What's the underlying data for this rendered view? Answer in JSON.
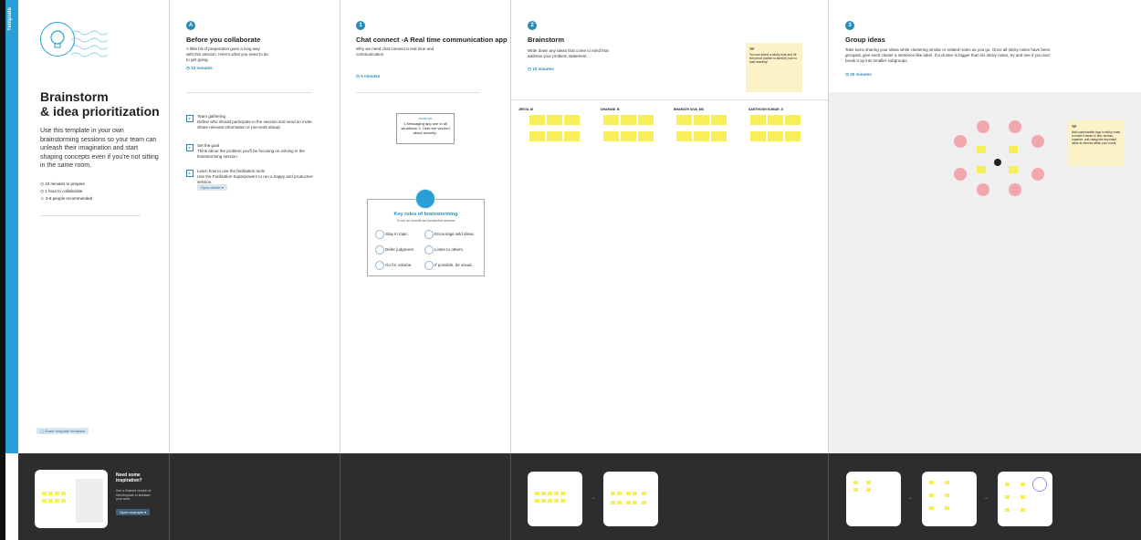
{
  "sidebar_tab": "Template",
  "intro": {
    "title_line1": "Brainstorm",
    "title_line2": "& idea prioritization",
    "description": "Use this template in your own brainstorming sessions so your team can unleash their imagination and start shaping concepts even if you're not sitting in the same room.",
    "meta": [
      "10 minutes to prepare",
      "1 hour to collaborate",
      "3-8 people recommended"
    ],
    "feedback_label": "Share template feedback",
    "inspiration_title": "Need some inspiration?",
    "inspiration_desc": "See a finished version of this template to kickstart your work.",
    "inspiration_button": "Open example"
  },
  "step1": {
    "title": "Before you collaborate",
    "desc": "A little bit of preparation goes a long way with this session. Here's what you need to do to get going.",
    "time": "10 minutes",
    "items": [
      {
        "label": "Team gathering",
        "text": "Define who should participate in the session and send an invite. Share relevant information or pre-work ahead."
      },
      {
        "label": "Set the goal",
        "text": "Think about the problem you'll be focusing on solving in the brainstorming session."
      },
      {
        "label": "Learn how to use the facilitation tools",
        "text": "Use the Facilitation Superpowers to run a happy and productive session."
      }
    ],
    "open_article": "Open article"
  },
  "step2": {
    "title": "Chat connect -A Real time communication app",
    "desc": "Why we need chat connect a real time and communication",
    "time": "5 minutes",
    "problem_label": "PROBLEM",
    "problem_text": "1.Messaging app use to all situations! 2. User are worried about security..",
    "key_rules_title": "Key rules of brainstorming",
    "key_rules_sub": "To run an smooth and productive session",
    "rules": [
      "Stay in topic.",
      "Encourage wild ideas.",
      "Defer judgment.",
      "Listen to others.",
      "Go for volume.",
      "If possible, be visual."
    ]
  },
  "step3": {
    "title": "Brainstorm",
    "desc": "Write down any ideas that come to mind that address your problem statement.",
    "time": "10 minutes",
    "tip_label": "TIP",
    "tip_text": "You can select a sticky note and hit the pencil (switch to sketch!) icon to start drawing!",
    "people": [
      "JEEVA .M",
      "DHARANI .B",
      "BHARATH SIVA .MS",
      "SANTHOSH KUMAR .S"
    ]
  },
  "step4": {
    "title": "Group ideas",
    "desc": "Take turns sharing your ideas while clustering similar or related notes as you go. Once all sticky notes have been grouped, give each cluster a sentence-like label. If a cluster is bigger than six sticky notes, try and see if you and break it up into smaller subgroups.",
    "time": "20 minutes",
    "tip_label": "TIP",
    "tip_text": "Add customizable tags to sticky notes to make it easier to find, browse, organize, and categorize important ideas as themes within your mural."
  }
}
